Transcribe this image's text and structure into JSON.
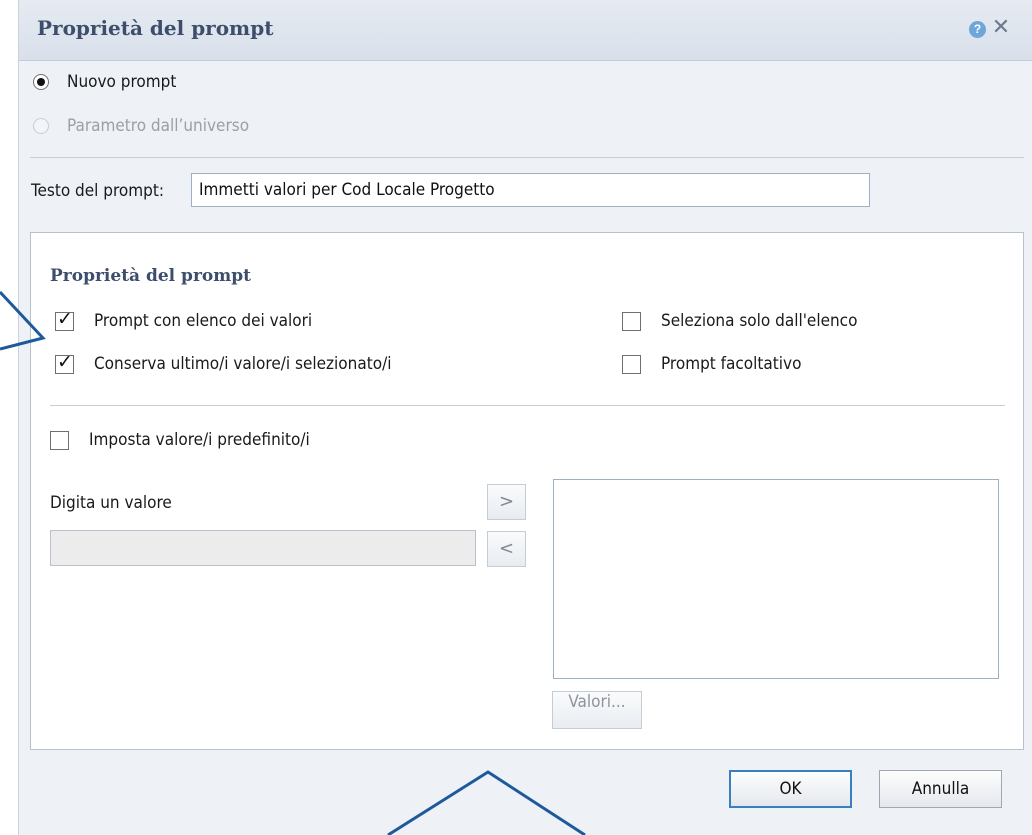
{
  "dialog": {
    "title": "Proprietà del prompt",
    "help_icon": "?",
    "close_icon": "✕"
  },
  "source": {
    "options": [
      {
        "label": "Nuovo prompt",
        "checked": true,
        "disabled": false
      },
      {
        "label": "Parametro dall’universo",
        "checked": false,
        "disabled": true
      }
    ]
  },
  "prompt_text": {
    "label": "Testo del prompt:",
    "value": "Immetti valori per Cod Locale Progetto"
  },
  "properties": {
    "title": "Proprietà del prompt",
    "options": {
      "prompt_with_list": {
        "label": "Prompt con elenco dei valori",
        "checked": true
      },
      "keep_last_values": {
        "label": "Conserva ultimo/i valore/i selezionato/i",
        "checked": true
      },
      "select_only_from_list": {
        "label": "Seleziona solo dall'elenco",
        "checked": false
      },
      "optional_prompt": {
        "label": "Prompt facoltativo",
        "checked": false
      }
    }
  },
  "defaults": {
    "set_default": {
      "label": "Imposta valore/i predefinito/i",
      "checked": false
    },
    "type_value_label": "Digita un valore",
    "type_value": "",
    "add_button": ">",
    "remove_button": "<",
    "values_button": "Valori..."
  },
  "footer": {
    "ok_label": "OK",
    "cancel_label": "Annulla"
  },
  "colors": {
    "title_text": "#3c4e6b",
    "dialog_bg": "#eef1f6",
    "annotation_line": "#1d5a99",
    "ok_border": "#3a7fc0"
  }
}
